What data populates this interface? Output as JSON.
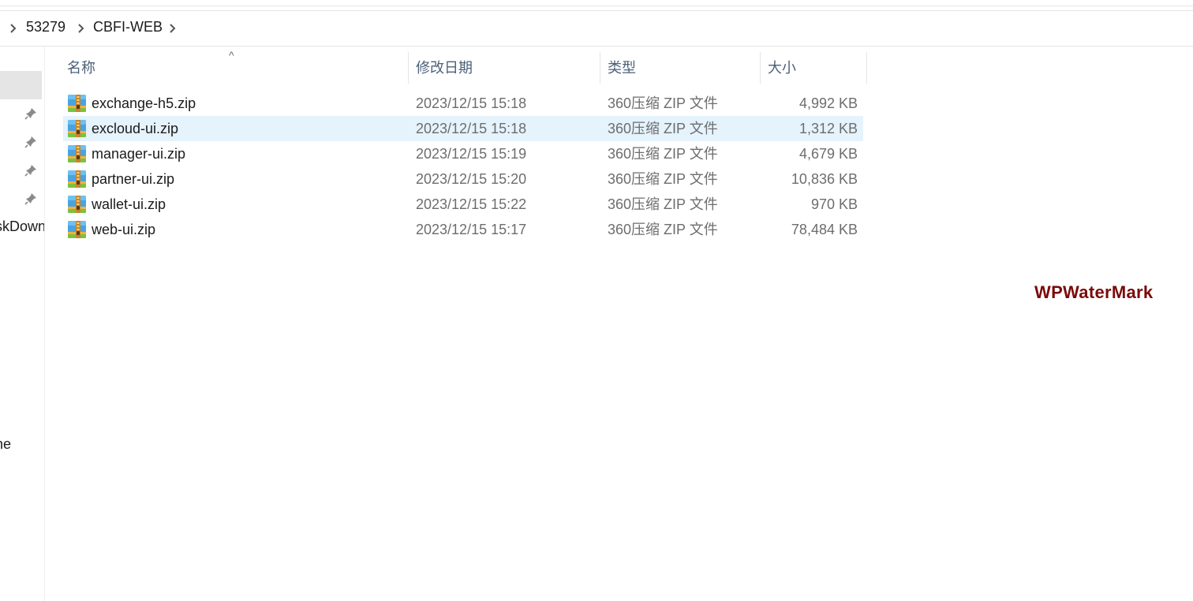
{
  "breadcrumb": {
    "items": [
      "53279",
      "CBFI-WEB"
    ]
  },
  "nav": {
    "partial_labels": [
      "skDown",
      "ne"
    ]
  },
  "columns": {
    "name": "名称",
    "date": "修改日期",
    "type": "类型",
    "size": "大小"
  },
  "files": [
    {
      "name": "exchange-h5.zip",
      "date": "2023/12/15 15:18",
      "type": "360压缩 ZIP 文件",
      "size": "4,992 KB",
      "selected": false
    },
    {
      "name": "excloud-ui.zip",
      "date": "2023/12/15 15:18",
      "type": "360压缩 ZIP 文件",
      "size": "1,312 KB",
      "selected": true
    },
    {
      "name": "manager-ui.zip",
      "date": "2023/12/15 15:19",
      "type": "360压缩 ZIP 文件",
      "size": "4,679 KB",
      "selected": false
    },
    {
      "name": "partner-ui.zip",
      "date": "2023/12/15 15:20",
      "type": "360压缩 ZIP 文件",
      "size": "10,836 KB",
      "selected": false
    },
    {
      "name": "wallet-ui.zip",
      "date": "2023/12/15 15:22",
      "type": "360压缩 ZIP 文件",
      "size": "970 KB",
      "selected": false
    },
    {
      "name": "web-ui.zip",
      "date": "2023/12/15 15:17",
      "type": "360压缩 ZIP 文件",
      "size": "78,484 KB",
      "selected": false
    }
  ],
  "watermark": "WPWaterMark",
  "colors": {
    "selected_row": "#e5f3fd",
    "header_text": "#4c607a",
    "watermark": "#7a0a0a"
  }
}
